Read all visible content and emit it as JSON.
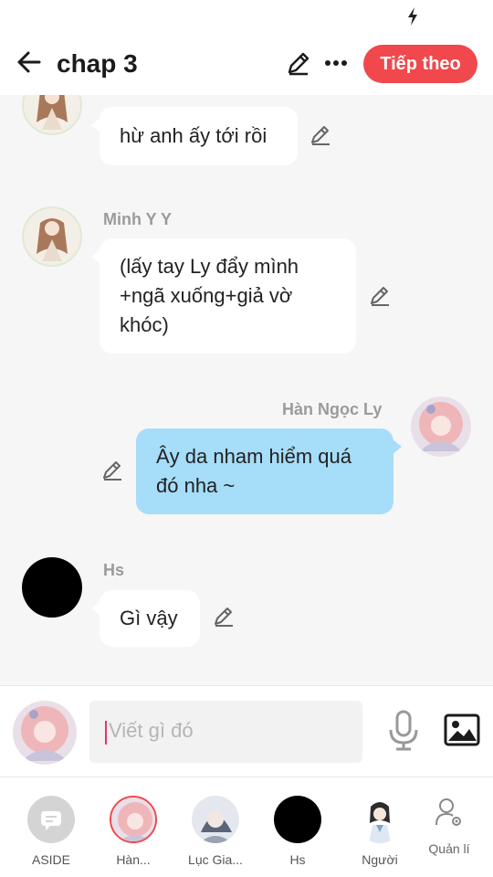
{
  "header": {
    "title": "chap 3",
    "next_button": "Tiếp theo"
  },
  "messages": [
    {
      "sender": "",
      "text": "hừ anh ấy tới rồi",
      "side": "left"
    },
    {
      "sender": "Minh Y Y",
      "text": "(lấy tay Ly đẩy mình +ngã xuống+giả vờ khóc)",
      "side": "left"
    },
    {
      "sender": "Hàn Ngọc Ly",
      "text": "Ây da nham hiểm quá đó nha ~",
      "side": "right"
    },
    {
      "sender": "Hs",
      "text": "Gì vậy",
      "side": "left"
    }
  ],
  "input": {
    "placeholder": "Viết gì đó"
  },
  "characters": [
    {
      "label": "ASIDE"
    },
    {
      "label": "Hàn..."
    },
    {
      "label": "Lục Gia..."
    },
    {
      "label": "Hs"
    },
    {
      "label": "Người"
    },
    {
      "label": "Quản lí"
    }
  ],
  "colors": {
    "accent": "#f0484d",
    "bubble_right": "#a6ddf9",
    "bubble_left": "#ffffff",
    "background": "#f6f6f6",
    "name_gray": "#9b9b9b"
  },
  "icons": {
    "back": "arrow-left-icon",
    "edit": "pencil-icon",
    "more": "ellipsis-icon",
    "mic": "microphone-icon",
    "image": "image-icon",
    "manage": "user-settings-icon",
    "aside": "chat-bubble-icon",
    "status": "lightning-icon"
  }
}
